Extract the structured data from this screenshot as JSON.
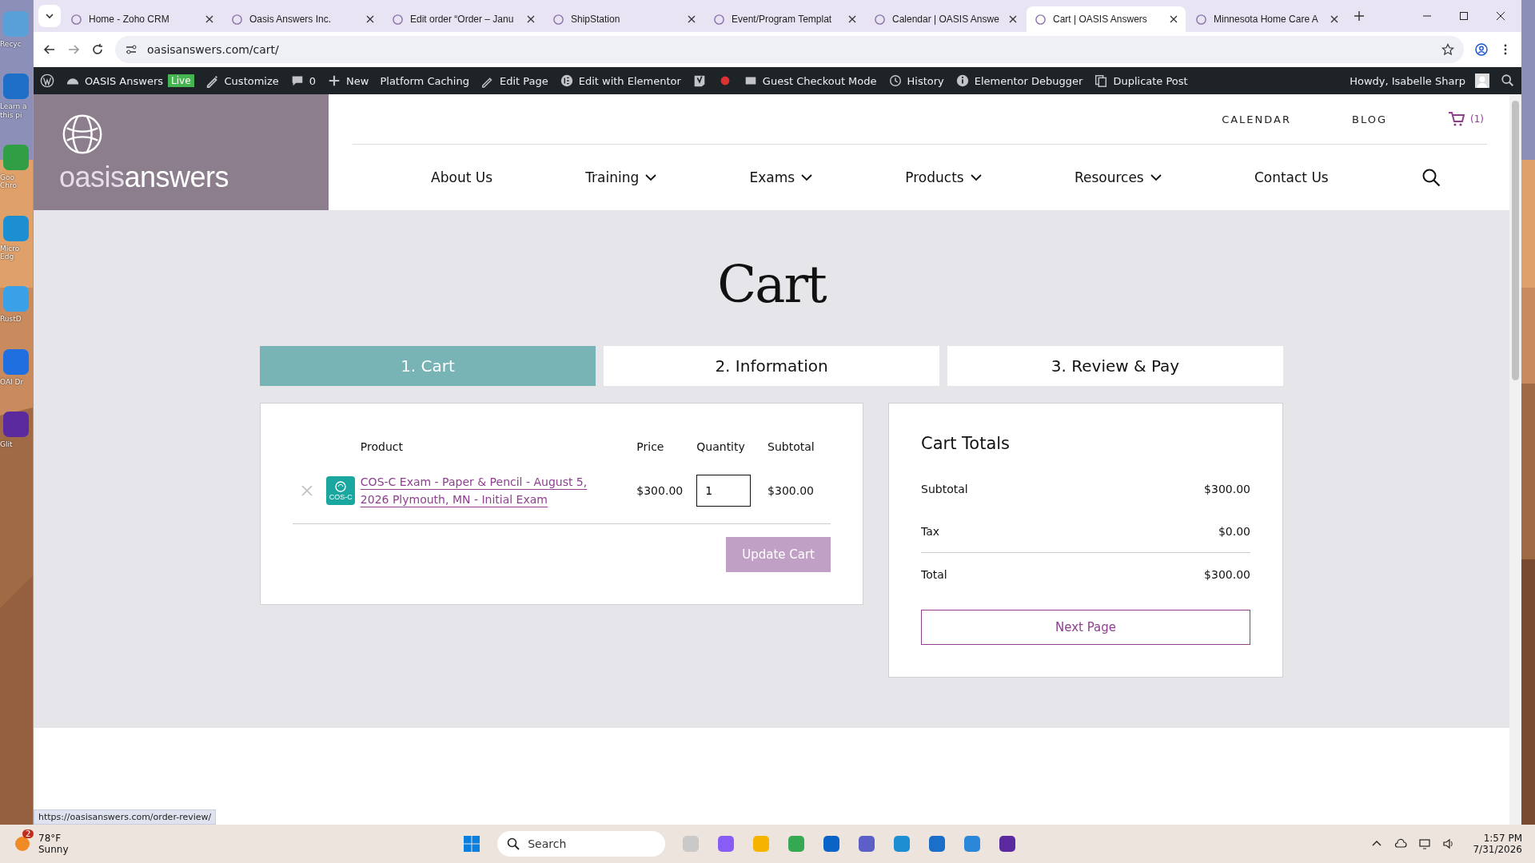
{
  "desktop_icons": [
    {
      "label": "Recyc",
      "color": "#5aa0d8"
    },
    {
      "label": "Learn a this pi",
      "color": "#1e6fc8"
    },
    {
      "label": "Goo Chro",
      "color": "#2f9e44"
    },
    {
      "label": "Micro Edg",
      "color": "#1b8fd1"
    },
    {
      "label": "RustD",
      "color": "#3aa0e8"
    },
    {
      "label": "OAI Dr",
      "color": "#1f6fe0"
    },
    {
      "label": "Glit",
      "color": "#5b2a9e"
    }
  ],
  "browser_tabs": [
    {
      "title": "Home - Zoho CRM",
      "selected": false
    },
    {
      "title": "Oasis Answers Inc.",
      "selected": false
    },
    {
      "title": "Edit order “Order – Janu",
      "selected": false
    },
    {
      "title": "ShipStation",
      "selected": false
    },
    {
      "title": "Event/Program Templat",
      "selected": false
    },
    {
      "title": "Calendar | OASIS Answe",
      "selected": false
    },
    {
      "title": "Cart | OASIS Answers",
      "selected": true
    },
    {
      "title": "Minnesota Home Care A",
      "selected": false
    }
  ],
  "address_bar": {
    "url": "oasisanswers.com/cart/"
  },
  "admin_bar": {
    "site": "OASIS Answers",
    "badge": "Live",
    "items": [
      "Customize",
      "0",
      "New",
      "Platform Caching",
      "Edit Page",
      "Edit with Elementor",
      "Guest Checkout Mode",
      "History",
      "Elementor Debugger",
      "Duplicate Post"
    ],
    "greeting": "Howdy, Isabelle Sharp"
  },
  "site_header": {
    "logo": {
      "first": "oasis",
      "second": "answers"
    },
    "top_links": [
      "CALENDAR",
      "BLOG"
    ],
    "cart_count": "(1)",
    "nav": [
      {
        "label": "About Us",
        "dropdown": false
      },
      {
        "label": "Training",
        "dropdown": true
      },
      {
        "label": "Exams",
        "dropdown": true
      },
      {
        "label": "Products",
        "dropdown": true
      },
      {
        "label": "Resources",
        "dropdown": true
      },
      {
        "label": "Contact Us",
        "dropdown": false
      }
    ]
  },
  "page_title": "Cart",
  "steps": [
    {
      "label": "1. Cart",
      "selected": true
    },
    {
      "label": "2. Information",
      "selected": false
    },
    {
      "label": "3. Review & Pay",
      "selected": false
    }
  ],
  "cart_table": {
    "columns": [
      "Product",
      "Price",
      "Quantity",
      "Subtotal"
    ],
    "rows": [
      {
        "product": "COS-C Exam - Paper & Pencil - August 5, 2026 Plymouth, MN - Initial Exam",
        "thumb_label": "COS-C",
        "price": "$300.00",
        "quantity": "1",
        "subtotal": "$300.00"
      }
    ],
    "update_button": "Update Cart"
  },
  "cart_totals": {
    "title": "Cart Totals",
    "rows": [
      {
        "label": "Subtotal",
        "value": "$300.00"
      },
      {
        "label": "Tax",
        "value": "$0.00"
      },
      {
        "label": "Total",
        "value": "$300.00"
      }
    ],
    "button": "Next Page"
  },
  "status_url": "https://oasisanswers.com/order-review/",
  "taskbar": {
    "weather": {
      "badge": "2",
      "temp": "78°F",
      "condition": "Sunny"
    },
    "search_placeholder": "Search",
    "time": "1:57 PM",
    "date": "7/31/2026"
  }
}
